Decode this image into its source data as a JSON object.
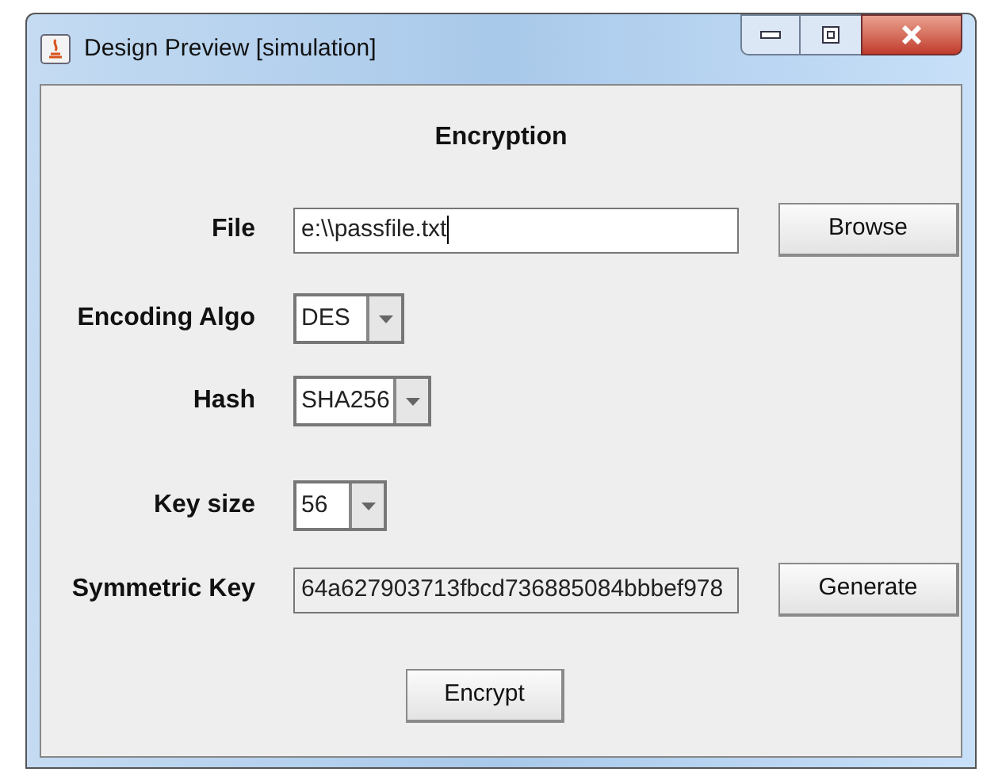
{
  "window": {
    "title": "Design Preview [simulation]"
  },
  "heading": "Encryption",
  "rows": [
    {
      "label": "File",
      "kind": "text",
      "value": "e:\\\\passfile.txt",
      "focused": true,
      "button": "Browse"
    },
    {
      "label": "Encoding Algo",
      "kind": "combo",
      "value": "DES"
    },
    {
      "label": "Hash",
      "kind": "combo",
      "value": "SHA256"
    },
    {
      "label": "Key size",
      "kind": "combo",
      "value": "56"
    },
    {
      "label": "Symmetric Key",
      "kind": "readonly",
      "value": "64a627903713fbcd736885084bbbef978",
      "button": "Generate"
    }
  ],
  "action": "Encrypt"
}
